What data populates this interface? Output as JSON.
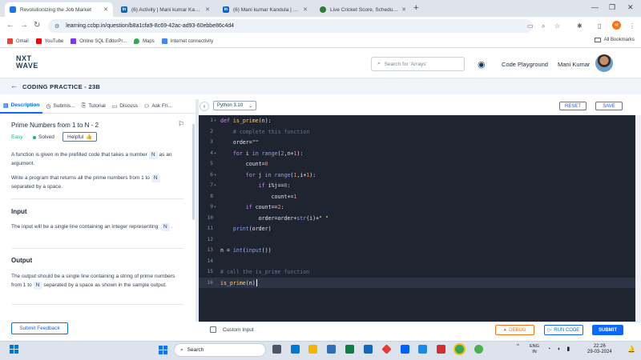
{
  "browser": {
    "tabs": [
      {
        "title": "Revolutionizing the Job Market",
        "active": true,
        "color": "#1a73e8"
      },
      {
        "title": "(6) Activity | Mani kumar Kandula",
        "active": false,
        "color": "#0a66c2"
      },
      {
        "title": "(6) Mani kumar Kandula | Linkedin",
        "active": false,
        "color": "#0a66c2"
      },
      {
        "title": "Live Cricket Score, Schedule, Lat",
        "active": false,
        "color": "#2e7d32"
      }
    ],
    "url": "learning.ccbp.in/question/b8a1cfa9-8c69-42ac-ad93-60ebbe86c4d4",
    "bookmarks": [
      "Gmail",
      "YouTube",
      "Online SQL EditorPr...",
      "Maps",
      "Internet connectivity"
    ],
    "all_bookmarks": "All Bookmarks",
    "profile_initials": "M"
  },
  "site": {
    "logo_line1": "NXT",
    "logo_line2": "WAVE",
    "search_placeholder": "Search for 'Arrays'",
    "code_playground": "Code Playground",
    "user_name": "Mani Kumar"
  },
  "practice": {
    "title": "CODING PRACTICE - 23B"
  },
  "left_tabs": [
    "Description",
    "Submis...",
    "Tutorial",
    "Discuss",
    "Ask Fri..."
  ],
  "problem": {
    "title": "Prime Numbers from 1 to N - 2",
    "difficulty": "Easy",
    "status": "Solved",
    "helpful": "Helpful",
    "desc1_a": "A function is given in the prefilled code that takes a number",
    "desc1_chip": "N",
    "desc1_b": "as an argument.",
    "desc2_a": "Write a program that returns all the prime numbers from 1 to",
    "desc2_chip": "N",
    "desc2_b": "separated by a space.",
    "input_heading": "Input",
    "input_text": "The input will be a single line containing an integer representing",
    "input_chip": "N",
    "input_tail": ".",
    "output_heading": "Output",
    "output_a": "The output should be a single line containing a string of prime numbers from 1 to",
    "output_chip": "N",
    "output_b": "separated by a space as shown in the sample output.",
    "submit_feedback": "Submit Feedback"
  },
  "editor": {
    "language": "Python 3.10",
    "reset": "RESET",
    "save": "SAVE",
    "lines": [
      "def is_prime(n):",
      "    # complete this function",
      "    order=\"\"",
      "    for i in range(2,n+1):",
      "        count=0",
      "        for j in range(1,i+1):",
      "            if i%j==0:",
      "                count+=1",
      "        if count==2:",
      "            order=order+str(i)+\" \"",
      "    print(order)",
      "",
      "n = int(input())",
      "",
      "# call the is_prime function",
      "is_prime(n)"
    ]
  },
  "bottom": {
    "custom_input": "Custom Input",
    "debug": "DEBUG",
    "run_code": "RUN CODE",
    "submit": "SUBMIT"
  },
  "taskbar": {
    "search": "Search",
    "lang_line1": "ENG",
    "lang_line2": "IN",
    "time": "22:26",
    "date": "29-03-2024"
  }
}
